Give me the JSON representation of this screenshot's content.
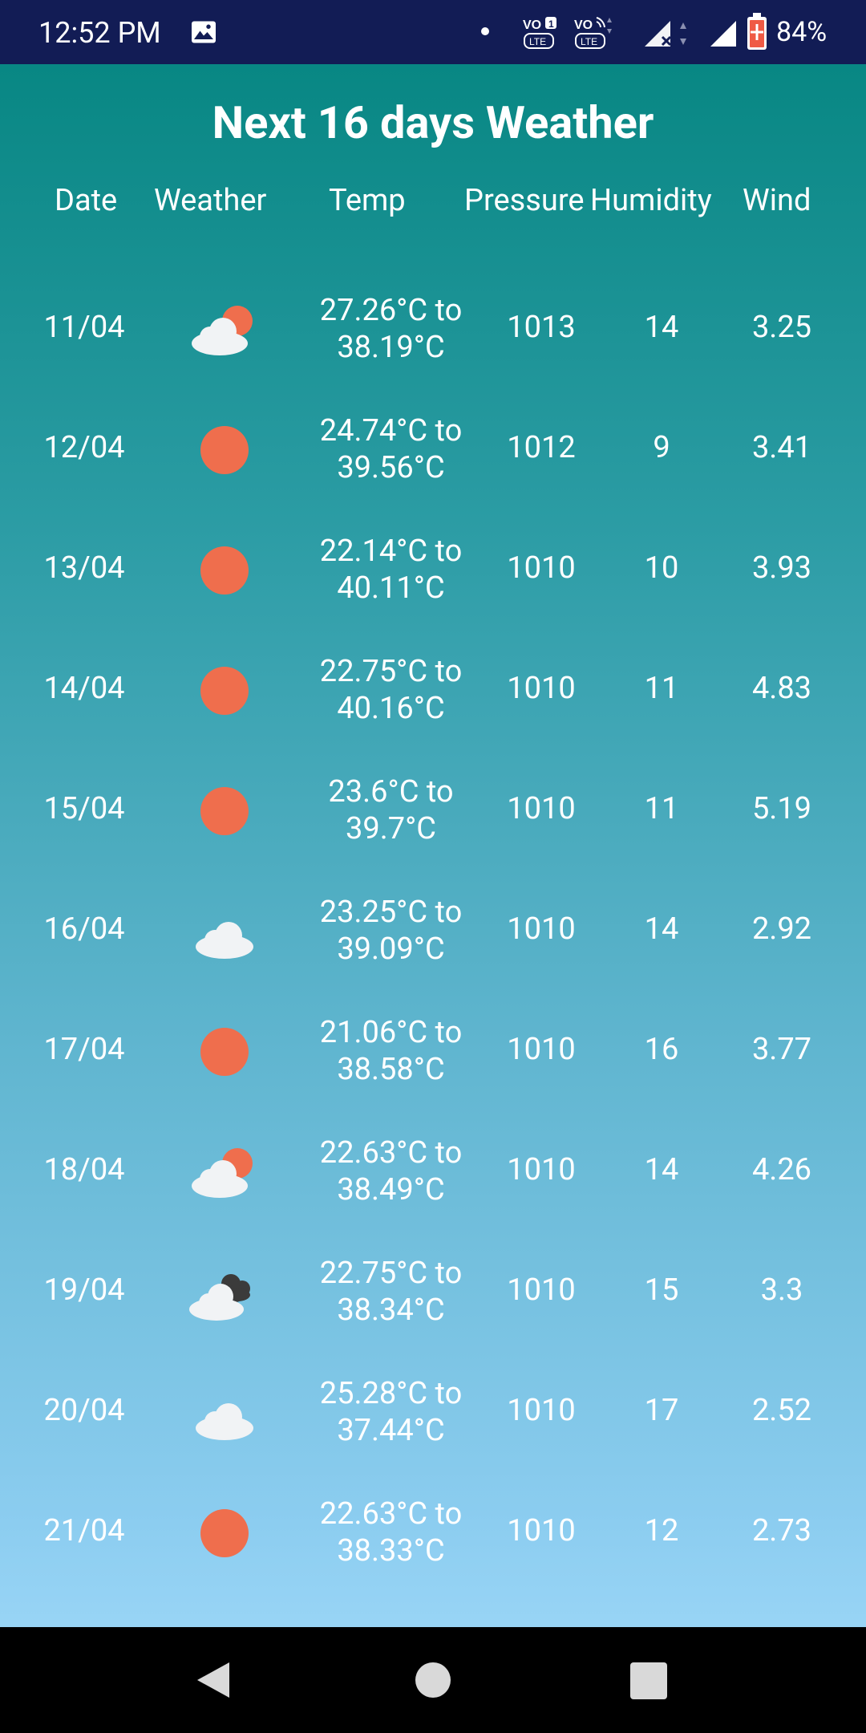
{
  "status_bar": {
    "time": "12:52 PM",
    "battery": "84%",
    "icons": [
      "gallery-icon",
      "dot-icon",
      "volte-icon",
      "volte-wifi-icon",
      "signal-icon",
      "battery-icon"
    ]
  },
  "title": "Next 16 days Weather",
  "columns": {
    "date": "Date",
    "weather": "Weather",
    "temp": "Temp",
    "pressure": "Pressure",
    "humidity": "Humidity",
    "wind": "Wind"
  },
  "rows": [
    {
      "date": "11/04",
      "icon": "sun-cloud-icon",
      "temp_line1": "27.26°C to",
      "temp_line2": "38.19°C",
      "pressure": "1013",
      "humidity": "14",
      "wind": "3.25"
    },
    {
      "date": "12/04",
      "icon": "sun-icon",
      "temp_line1": "24.74°C to",
      "temp_line2": "39.56°C",
      "pressure": "1012",
      "humidity": "9",
      "wind": "3.41"
    },
    {
      "date": "13/04",
      "icon": "sun-icon",
      "temp_line1": "22.14°C to",
      "temp_line2": "40.11°C",
      "pressure": "1010",
      "humidity": "10",
      "wind": "3.93"
    },
    {
      "date": "14/04",
      "icon": "sun-icon",
      "temp_line1": "22.75°C to",
      "temp_line2": "40.16°C",
      "pressure": "1010",
      "humidity": "11",
      "wind": "4.83"
    },
    {
      "date": "15/04",
      "icon": "sun-icon",
      "temp_line1": "23.6°C to",
      "temp_line2": "39.7°C",
      "pressure": "1010",
      "humidity": "11",
      "wind": "5.19"
    },
    {
      "date": "16/04",
      "icon": "cloud-icon",
      "temp_line1": "23.25°C to",
      "temp_line2": "39.09°C",
      "pressure": "1010",
      "humidity": "14",
      "wind": "2.92"
    },
    {
      "date": "17/04",
      "icon": "sun-icon",
      "temp_line1": "21.06°C to",
      "temp_line2": "38.58°C",
      "pressure": "1010",
      "humidity": "16",
      "wind": "3.77"
    },
    {
      "date": "18/04",
      "icon": "sun-cloud-icon",
      "temp_line1": "22.63°C to",
      "temp_line2": "38.49°C",
      "pressure": "1010",
      "humidity": "14",
      "wind": "4.26"
    },
    {
      "date": "19/04",
      "icon": "dark-cloud-icon",
      "temp_line1": "22.75°C to",
      "temp_line2": "38.34°C",
      "pressure": "1010",
      "humidity": "15",
      "wind": "3.3"
    },
    {
      "date": "20/04",
      "icon": "cloud-icon",
      "temp_line1": "25.28°C to",
      "temp_line2": "37.44°C",
      "pressure": "1010",
      "humidity": "17",
      "wind": "2.52"
    },
    {
      "date": "21/04",
      "icon": "sun-icon",
      "temp_line1": "22.63°C to",
      "temp_line2": "38.33°C",
      "pressure": "1010",
      "humidity": "12",
      "wind": "2.73"
    }
  ],
  "nav_bar": {
    "icons": [
      "back-icon",
      "home-icon",
      "recents-icon"
    ]
  },
  "colors": {
    "status_bar": "#121c55",
    "gradient_top": "#03847f",
    "gradient_bottom": "#a5dcfb",
    "sun": "#ef6e4d",
    "cloud": "#f1f3f5",
    "dark_cloud": "#3b3b3b"
  }
}
